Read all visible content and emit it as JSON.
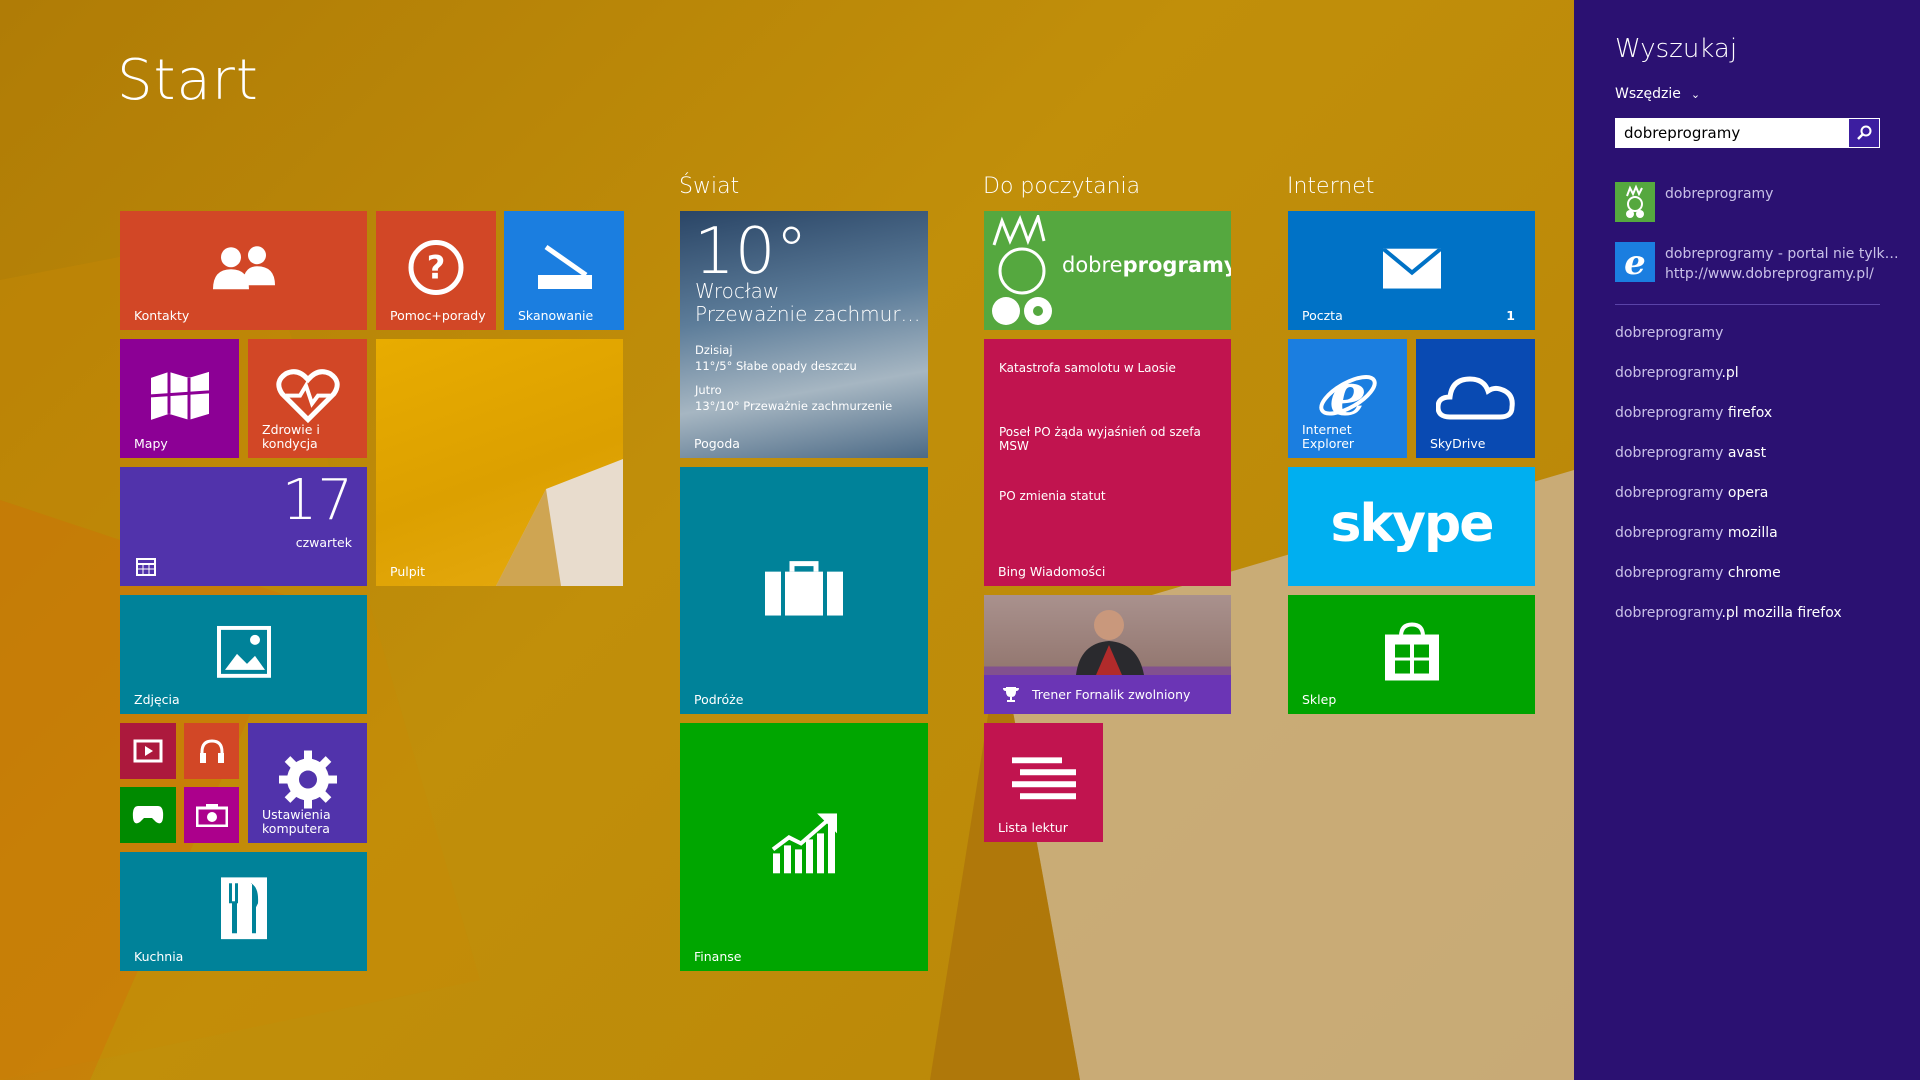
{
  "start": {
    "title": "Start"
  },
  "groups": {
    "world": "Świat",
    "reading": "Do poczytania",
    "internet": "Internet"
  },
  "tiles": {
    "contacts": "Kontakty",
    "help": "Pomoc+porady",
    "scan": "Skanowanie",
    "maps": "Mapy",
    "health": "Zdrowie i\nkondycja",
    "desktop": "Pulpit",
    "calendar_day": "17",
    "calendar_weekday": "czwartek",
    "photos": "Zdjęcia",
    "settings": "Ustawienia\nkomputera",
    "food": "Kuchnia",
    "weather": {
      "temp": "10°",
      "city": "Wrocław",
      "desc": "Przeważnie zachmur…",
      "today_label": "Dzisiaj",
      "today": "11°/5° Słabe opady deszczu",
      "tomorrow_label": "Jutro",
      "tomorrow": "13°/10° Przeważnie zachmurzenie",
      "label": "Pogoda"
    },
    "travel": "Podróże",
    "finance": "Finanse",
    "dp_logo_pre": "dobre",
    "dp_logo_post": "programy",
    "news": {
      "line1": "Katastrofa samolotu w Laosie",
      "line2": "Poseł PO żąda wyjaśnień od szefa MSW",
      "line3": "PO zmienia statut",
      "label": "Bing Wiadomości"
    },
    "sport": "Trener Fornalik zwolniony",
    "reading_list": "Lista lektur",
    "mail": "Poczta",
    "mail_badge": "1",
    "ie": "Internet Explorer",
    "skydrive": "SkyDrive",
    "skype": "skype",
    "store": "Sklep"
  },
  "search": {
    "title": "Wyszukaj",
    "scope": "Wszędzie",
    "query": "dobreprogramy",
    "results": [
      {
        "title": "dobreprogramy",
        "sub": ""
      },
      {
        "title": "dobreprogramy - portal nie tylk…",
        "sub": "http://www.dobreprogramy.pl/"
      }
    ],
    "suggestions": [
      {
        "base": "dobreprogramy",
        "extra": ""
      },
      {
        "base": "dobreprogramy",
        "extra": ".pl"
      },
      {
        "base": "dobreprogramy",
        "extra": " firefox"
      },
      {
        "base": "dobreprogramy",
        "extra": " avast"
      },
      {
        "base": "dobreprogramy",
        "extra": " opera"
      },
      {
        "base": "dobreprogramy",
        "extra": " mozilla"
      },
      {
        "base": "dobreprogramy",
        "extra": " chrome"
      },
      {
        "base": "dobreprogramy",
        "extra": ".pl mozilla firefox"
      }
    ]
  },
  "colors": {
    "contacts": "#d24726",
    "help": "#d24726",
    "scan": "#1b7ee0",
    "maps": "#8c0095",
    "health": "#d24726",
    "desktop": "#e5a400",
    "calendar": "#5133ab",
    "photos": "#008299",
    "small_video": "#ac193d",
    "small_music": "#d24726",
    "small_games": "#008a00",
    "small_camera": "#ac008c",
    "settings": "#5133ab",
    "food": "#008299",
    "weather": "#3a5a7a",
    "travel": "#008299",
    "finance": "#00a600",
    "dobreprogramy": "#55a83f",
    "news": "#c1144f",
    "sport": "#6b35b5",
    "reading_list": "#c1144f",
    "mail": "#0072c6",
    "ie": "#1b7ee0",
    "skydrive": "#094ab2",
    "skype": "#00aff0",
    "store": "#00a300",
    "panel": "#2b1172"
  }
}
